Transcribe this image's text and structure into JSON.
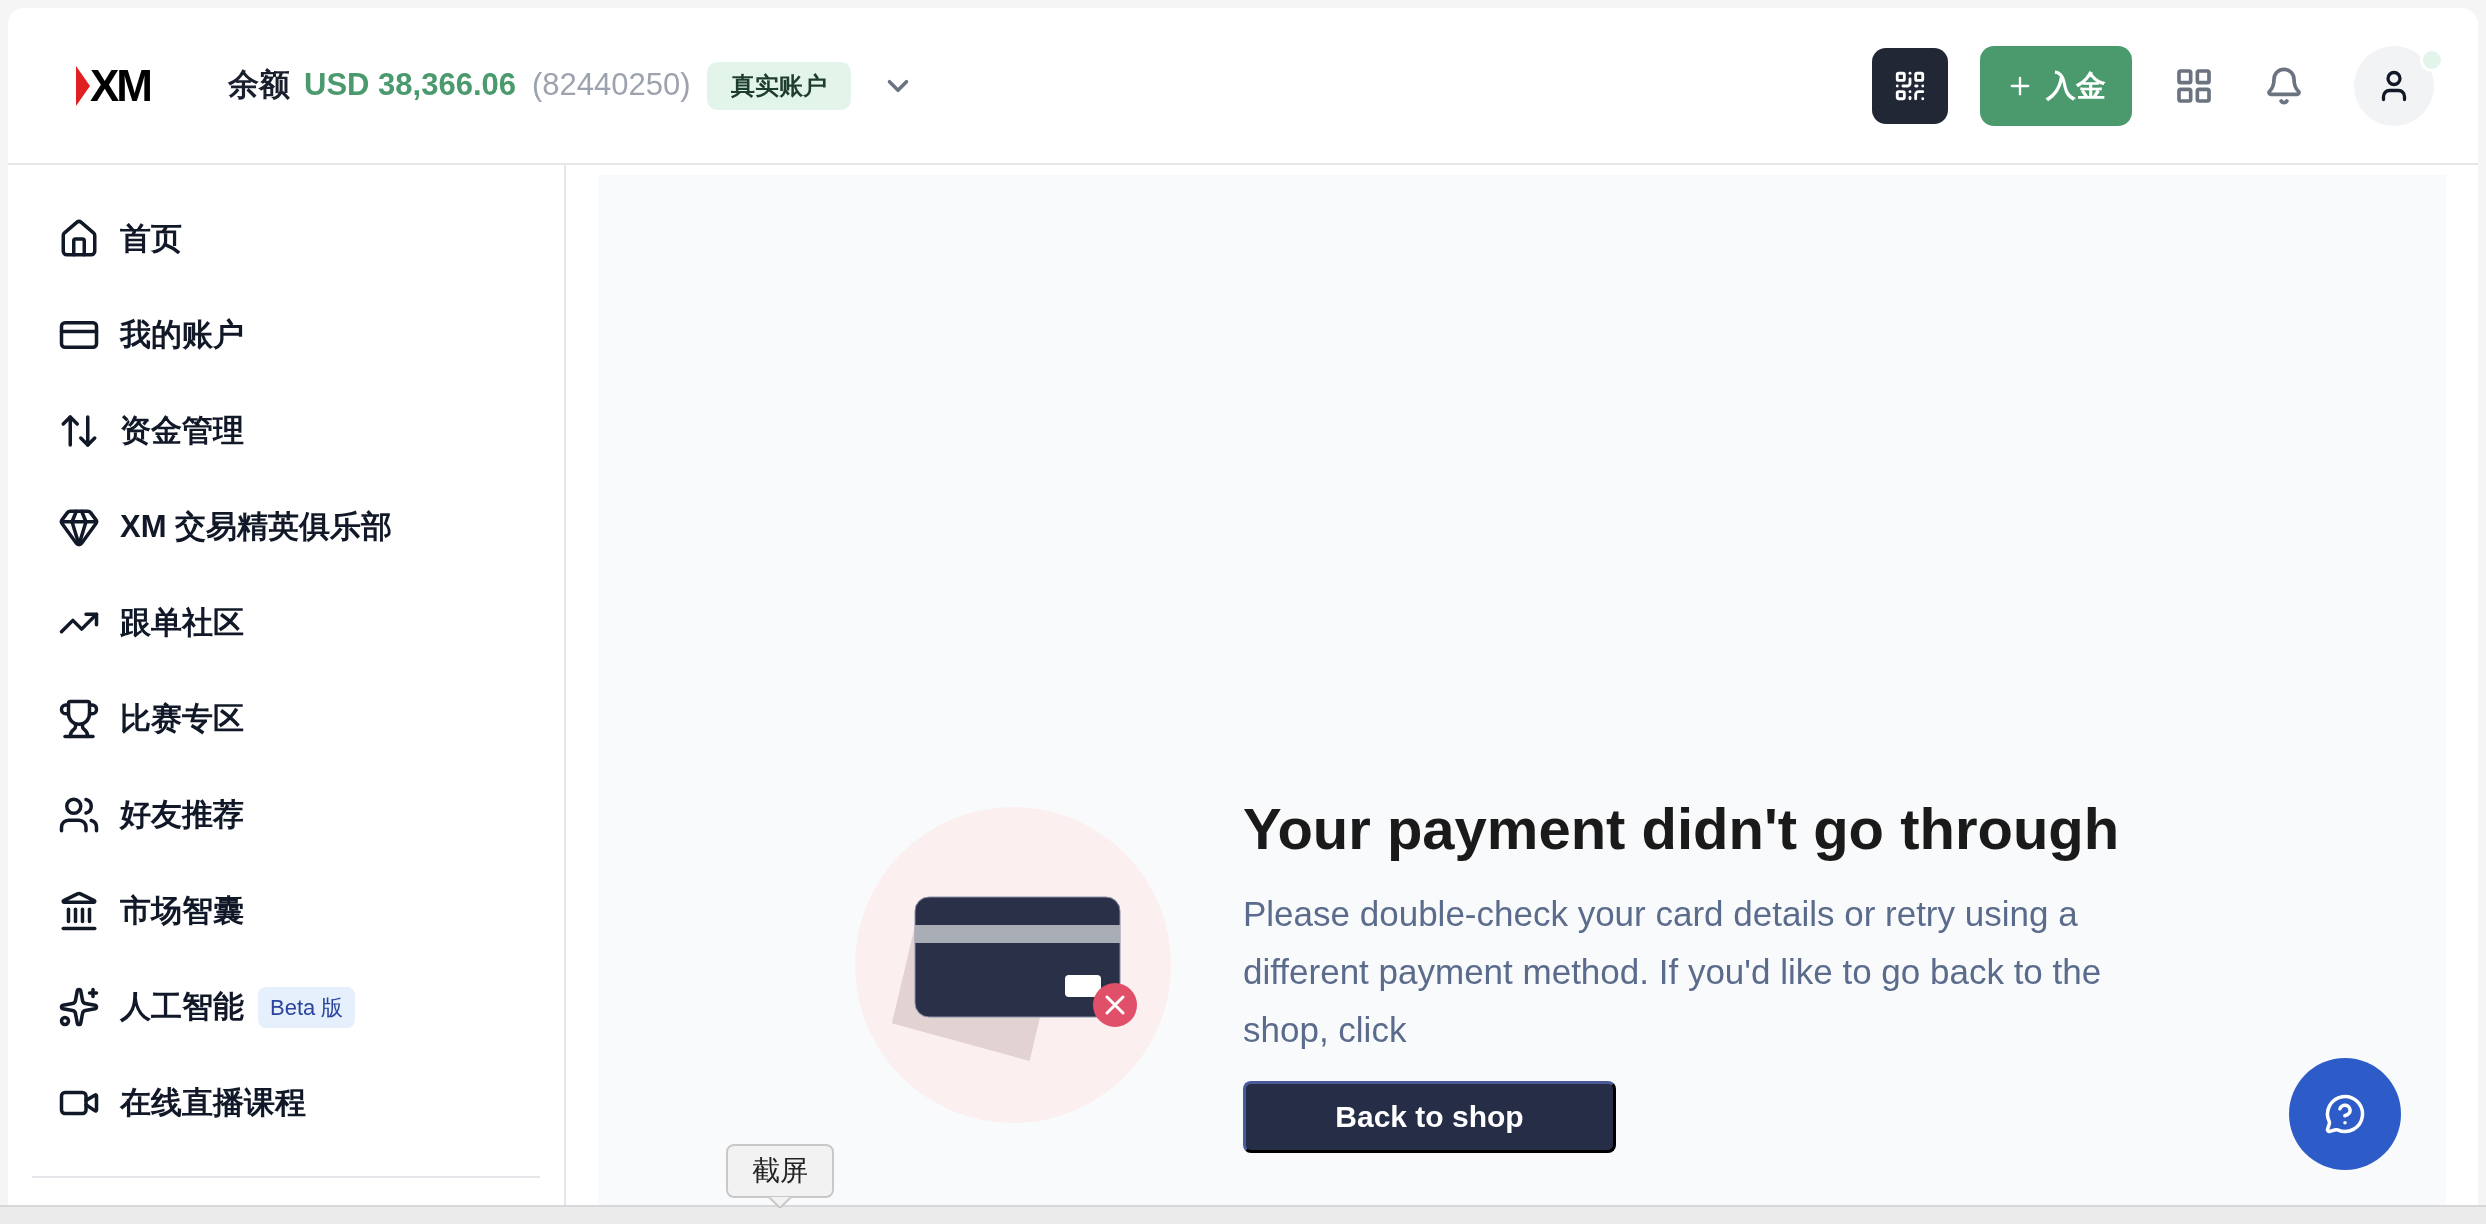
{
  "header": {
    "logo": "XM",
    "balance_label": "余额",
    "balance": "USD 38,366.06",
    "account_number": "(82440250)",
    "account_type": "真实账户",
    "deposit_label": "入金"
  },
  "sidebar": {
    "items": [
      {
        "label": "首页"
      },
      {
        "label": "我的账户"
      },
      {
        "label": "资金管理"
      },
      {
        "label": "XM 交易精英俱乐部"
      },
      {
        "label": "跟单社区"
      },
      {
        "label": "比赛专区"
      },
      {
        "label": "好友推荐"
      },
      {
        "label": "市场智囊"
      },
      {
        "label": "人工智能",
        "badge": "Beta 版"
      },
      {
        "label": "在线直播课程"
      }
    ]
  },
  "payment_error": {
    "title": "Your payment didn't go through",
    "message": "Please double-check your card details or retry using a different payment method. If you'd like to go back to the shop, click",
    "button": "Back to shop"
  },
  "tooltip": "截屏"
}
